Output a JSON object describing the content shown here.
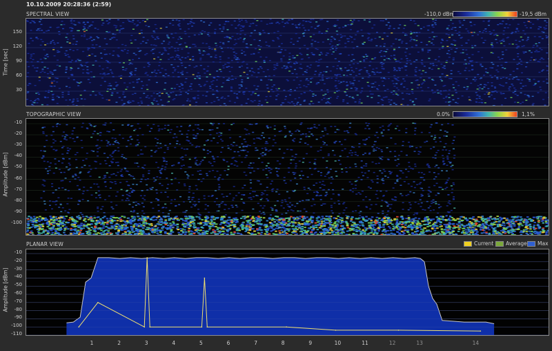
{
  "header": {
    "timestamp": "10.10.2009 20:28:36 (2:59)"
  },
  "spectral": {
    "title": "SPECTRAL VIEW",
    "scale_min": "-110,0 dBm",
    "scale_max": "-19,5 dBm",
    "ylabel": "Time [sec]",
    "yticks": [
      "150",
      "120",
      "90",
      "60",
      "30"
    ]
  },
  "topographic": {
    "title": "TOPOGRAPHIC VIEW",
    "scale_min": "0.0%",
    "scale_max": "1,1%",
    "ylabel": "Amplitude [dBm]",
    "yticks": [
      "-10",
      "-20",
      "-30",
      "-40",
      "-50",
      "-60",
      "-70",
      "-80",
      "-90",
      "-100"
    ]
  },
  "planar": {
    "title": "PLANAR VIEW",
    "ylabel": "Amplitude [dBm]",
    "yticks": [
      "-10",
      "-20",
      "-30",
      "-40",
      "-50",
      "-60",
      "-70",
      "-80",
      "-90",
      "-100",
      "-110"
    ],
    "legend": [
      {
        "label": "Current",
        "color": "#f0d020"
      },
      {
        "label": "Average",
        "color": "#7aa83a"
      },
      {
        "label": "Max",
        "color": "#2f5fd0"
      }
    ]
  },
  "xaxis": {
    "ticks": [
      "1",
      "2",
      "3",
      "4",
      "5",
      "6",
      "7",
      "8",
      "9",
      "10",
      "11",
      "12",
      "13",
      "14"
    ]
  },
  "colors": {
    "max_fill": "#0f2fa8",
    "max_line": "#c8c8c8",
    "current": "#f0e070",
    "grid": "#3a3a3a"
  },
  "chart_data": {
    "type": "area",
    "title": "PLANAR VIEW",
    "xlabel": "",
    "ylabel": "Amplitude [dBm]",
    "ylim": [
      -110,
      -5
    ],
    "x_channels": [
      1,
      2,
      3,
      4,
      5,
      6,
      7,
      8,
      9,
      10,
      11,
      12,
      13,
      14
    ],
    "series": [
      {
        "name": "Max",
        "x": [
          0.05,
          0.3,
          0.55,
          0.75,
          0.95,
          1.2,
          1.6,
          2.0,
          2.4,
          2.8,
          3.2,
          3.6,
          4.0,
          4.4,
          4.8,
          5.2,
          5.6,
          6.0,
          6.4,
          6.8,
          7.2,
          7.6,
          8.0,
          8.4,
          8.8,
          9.2,
          9.6,
          10.0,
          10.4,
          10.8,
          11.2,
          11.6,
          12.0,
          12.4,
          12.8,
          13.0,
          13.15,
          13.3,
          13.45,
          13.6,
          13.8,
          14.2,
          14.6,
          15.0,
          15.4,
          15.7
        ],
        "values": [
          -95,
          -94,
          -88,
          -45,
          -40,
          -15,
          -15,
          -16,
          -15,
          -16,
          -15,
          -16,
          -15,
          -16,
          -15,
          -15,
          -16,
          -15,
          -16,
          -15,
          -15,
          -16,
          -15,
          -15,
          -16,
          -15,
          -15,
          -16,
          -15,
          -16,
          -15,
          -16,
          -15,
          -16,
          -15,
          -16,
          -20,
          -50,
          -65,
          -72,
          -92,
          -93,
          -94,
          -94,
          -94,
          -96
        ]
      },
      {
        "name": "Current",
        "x": [
          0.5,
          1.2,
          2.9,
          3.0,
          3.1,
          5.0,
          5.1,
          5.2,
          8.1,
          9.9,
          12.2,
          15.2
        ],
        "values": [
          -100,
          -70,
          -100,
          -15,
          -100,
          -100,
          -40,
          -100,
          -100,
          -104,
          -104,
          -105
        ]
      }
    ]
  }
}
